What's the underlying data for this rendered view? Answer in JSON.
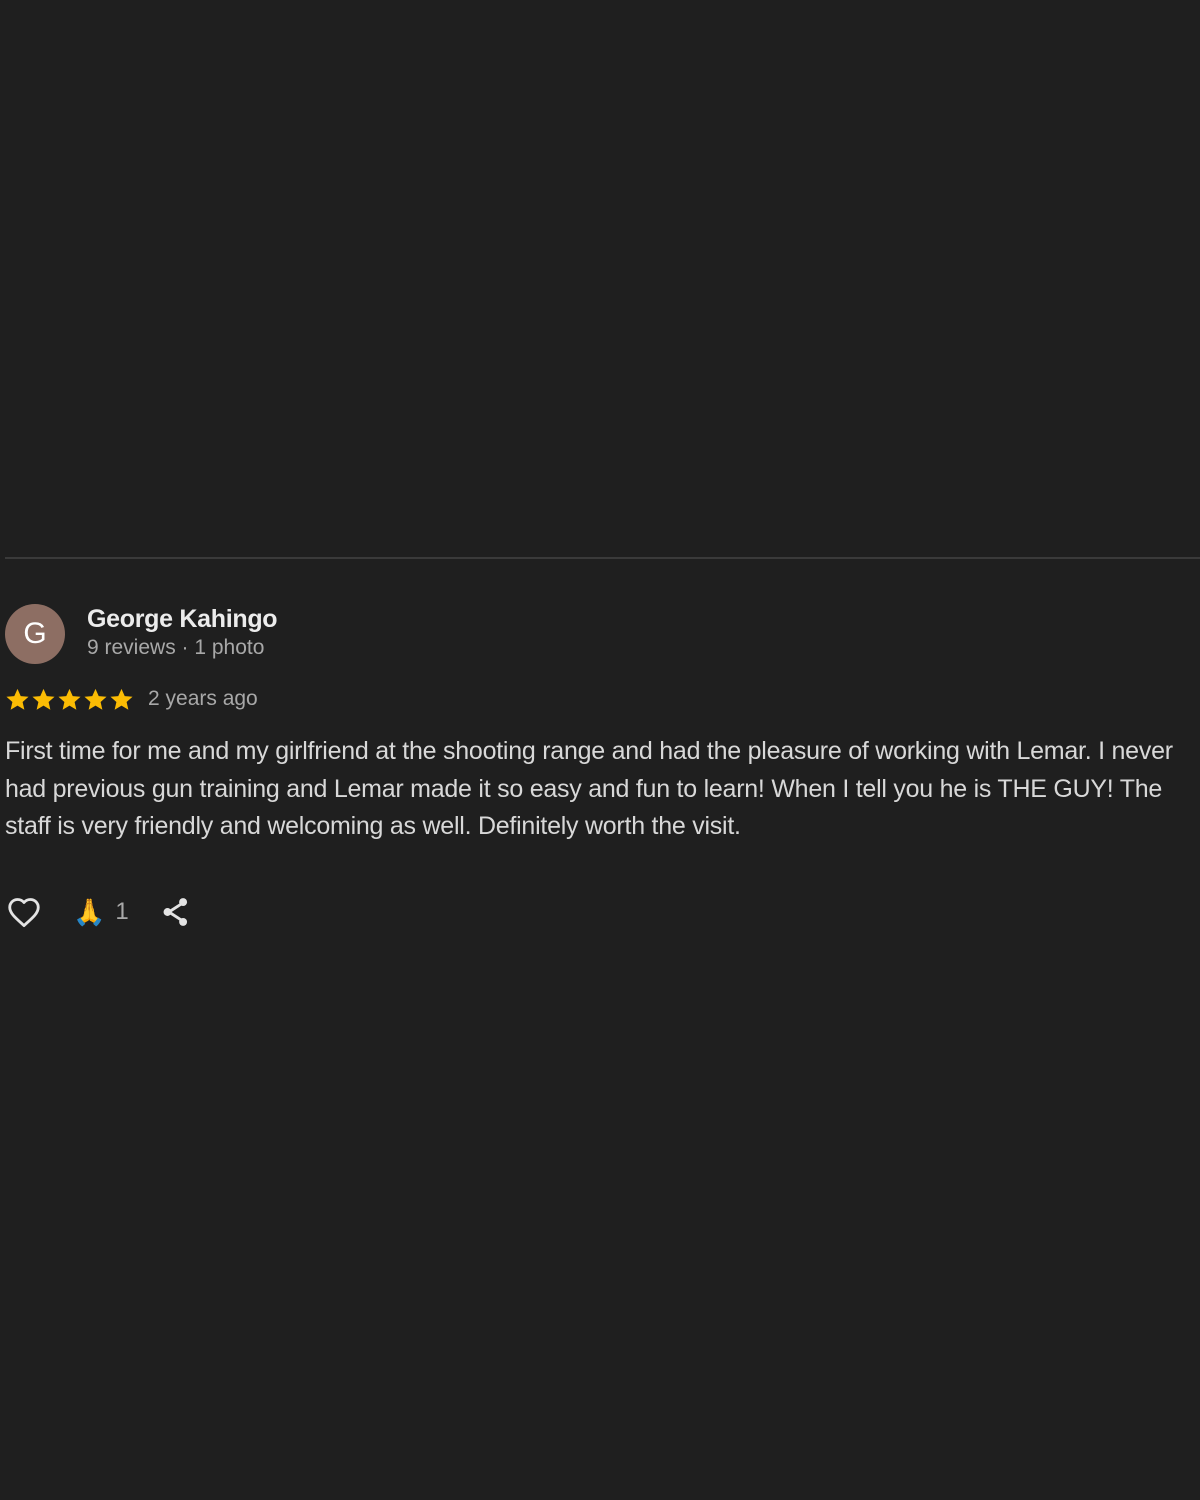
{
  "review": {
    "avatar_letter": "G",
    "author_name": "George Kahingo",
    "author_meta": "9 reviews · 1 photo",
    "rating": 5,
    "rating_max": 5,
    "time_ago": "2 years ago",
    "text": "First time for me and my girlfriend at the shooting range and had the pleasure of working with Lemar. I never had previous gun training and Lemar made it so easy and fun to learn! When I tell you he is THE GUY! The staff is very friendly and welcoming as well. Definitely worth the visit.",
    "reaction_emoji": "🙏",
    "reaction_count": "1"
  },
  "icons": {
    "like": "heart-outline-icon",
    "star": "star-icon",
    "share": "share-icon"
  },
  "colors": {
    "background": "#1f1f1f",
    "avatar": "#8d6e63",
    "star": "#fbbc04",
    "icon": "#e3e3e3",
    "secondary_text": "#a8a8a8"
  }
}
